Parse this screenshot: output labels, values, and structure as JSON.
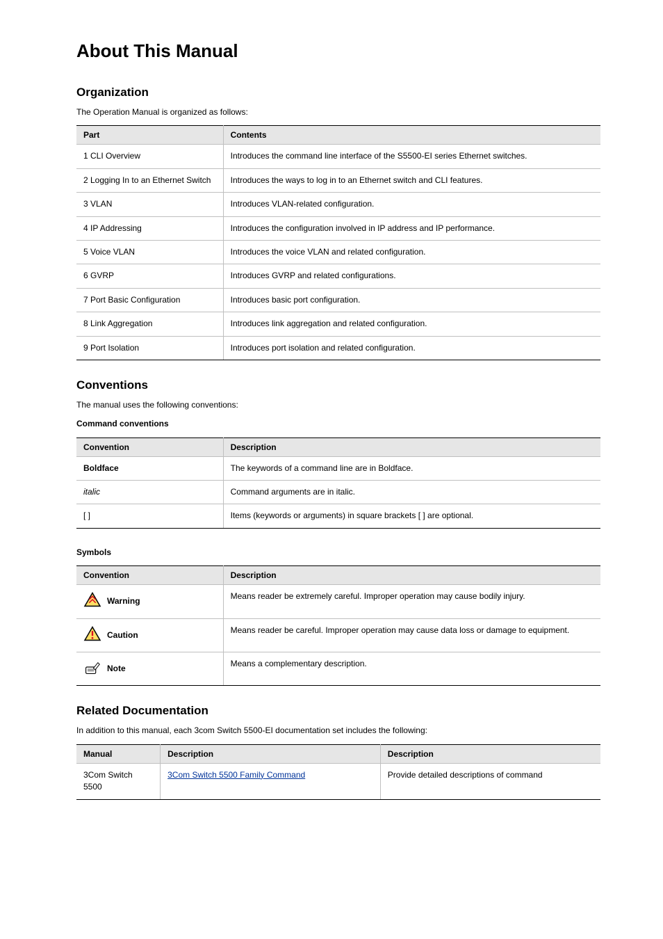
{
  "title": "About This Manual",
  "organization": {
    "heading": "Organization",
    "lead": "The Operation Manual is organized as follows:",
    "table": {
      "headers": [
        "Part",
        "Contents"
      ],
      "rows": [
        [
          "1 CLI Overview",
          "Introduces the command line interface of the S5500-EI series Ethernet switches."
        ],
        [
          "2 Logging In to an Ethernet Switch",
          "Introduces the ways to log in to an Ethernet switch and CLI features."
        ],
        [
          "3 VLAN",
          "Introduces VLAN-related configuration."
        ],
        [
          "4 IP Addressing",
          "Introduces the configuration involved in IP address and IP performance."
        ],
        [
          "5 Voice VLAN",
          "Introduces the voice VLAN and related configuration."
        ],
        [
          "6 GVRP",
          "Introduces GVRP and related configurations."
        ],
        [
          "7 Port Basic Configuration",
          "Introduces basic port configuration."
        ],
        [
          "8 Link Aggregation",
          "Introduces link aggregation and related configuration."
        ],
        [
          "9 Port Isolation",
          "Introduces port isolation and related configuration."
        ]
      ]
    }
  },
  "conventions": {
    "heading": "Conventions",
    "lead": "The manual uses the following conventions:"
  },
  "cmdConventions": {
    "heading": "Command conventions",
    "table": {
      "headers": [
        "Convention",
        "Description"
      ],
      "rows": [
        [
          "Boldface",
          "The keywords of a command line are in Boldface."
        ],
        [
          "italic",
          "Command arguments are in italic."
        ],
        [
          "[ ]",
          "Items (keywords or arguments) in square brackets [ ] are optional."
        ]
      ],
      "styles": [
        "bold",
        "italic",
        "normal"
      ]
    }
  },
  "symbols": {
    "heading": "Symbols",
    "table": {
      "headers": [
        "Convention",
        "Description"
      ],
      "rows": [
        {
          "icon": "warning",
          "label": "Warning",
          "desc": "Means reader be extremely careful. Improper operation may cause bodily injury."
        },
        {
          "icon": "caution",
          "label": "Caution",
          "desc": "Means reader be careful. Improper operation may cause data loss or damage to equipment."
        },
        {
          "icon": "note",
          "label": "Note",
          "desc": "Means a complementary description."
        }
      ]
    }
  },
  "related": {
    "heading": "Related Documentation",
    "lead": "In addition to this manual, each 3com Switch 5500-EI documentation set includes the following:",
    "table": {
      "headers": [
        "Manual",
        "Description",
        "Description"
      ],
      "rows": [
        {
          "manual": "3Com Switch 5500",
          "linkText": "3Com Switch 5500 Family Command",
          "desc": "Provide detailed descriptions of command"
        }
      ]
    }
  }
}
